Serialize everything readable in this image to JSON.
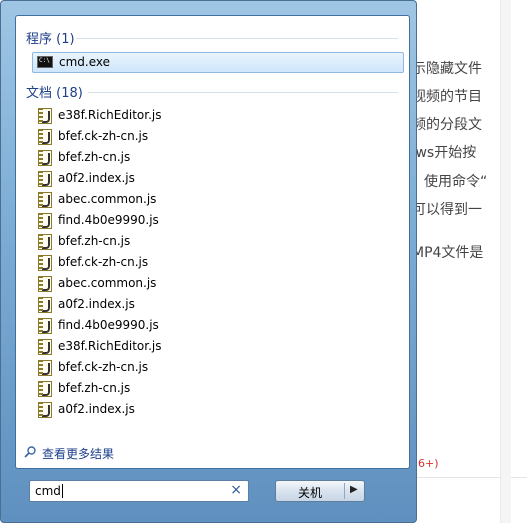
{
  "background_article": {
    "lines": [
      "显示隐藏文件",
      "讯视频的节目",
      "视频的分段文",
      "dows开始按",
      "使用命令“",
      "就可以得到一",
      "MP4文件是"
    ],
    "badge": "6+)"
  },
  "start_menu": {
    "programs": {
      "header": "程序 (1)",
      "items": [
        {
          "label": "cmd.exe",
          "icon": "console-icon"
        }
      ]
    },
    "documents": {
      "header": "文档 (18)",
      "items": [
        "e38f.RichEditor.js",
        "bfef.ck-zh-cn.js",
        "bfef.zh-cn.js",
        "a0f2.index.js",
        "abec.common.js",
        "find.4b0e9990.js",
        "bfef.zh-cn.js",
        "bfef.ck-zh-cn.js",
        "abec.common.js",
        "a0f2.index.js",
        "find.4b0e9990.js",
        "e38f.RichEditor.js",
        "bfef.ck-zh-cn.js",
        "bfef.zh-cn.js",
        "a0f2.index.js"
      ]
    },
    "more_results": "查看更多结果",
    "search": {
      "value": "cmd",
      "clear_icon": "close-icon"
    },
    "shutdown": {
      "label": "关机",
      "arrow_icon": "triangle-right-icon"
    }
  },
  "colors": {
    "accent": "#1e3f8a",
    "selection": "#cfe6fb",
    "glass": "#7eaed6"
  }
}
